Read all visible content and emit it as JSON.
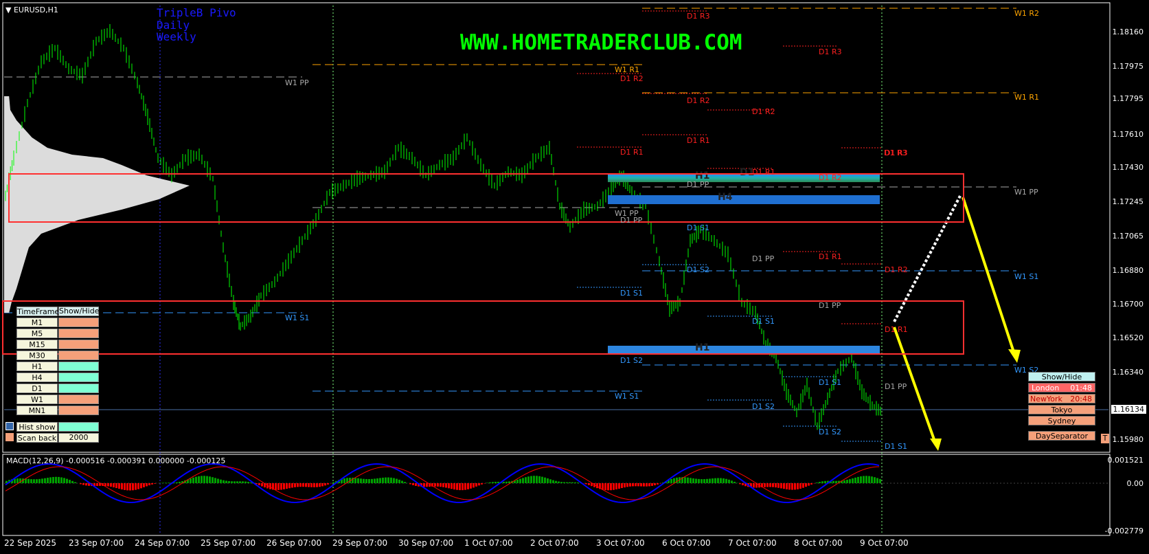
{
  "symbol": "EURUSD,H1",
  "indicator_title": [
    "TripleB Pivo",
    "Daily",
    "Weekly"
  ],
  "watermark": "WWW.HOMETRADERCLUB.COM",
  "macd_label": "MACD(12,26,9) -0.000516 -0.000391 0.000000 -0.000125",
  "price_axis": [
    "1.18160",
    "1.17975",
    "1.17795",
    "1.17610",
    "1.17430",
    "1.17245",
    "1.17065",
    "1.16880",
    "1.16700",
    "1.16520",
    "1.16340",
    "1.16134",
    "1.15980"
  ],
  "current_price": "1.16134",
  "macd_axis": [
    "0.001521",
    "0.00",
    "-0.002779"
  ],
  "time_axis": [
    "22 Sep 2025",
    "23 Sep 07:00",
    "24 Sep 07:00",
    "25 Sep 07:00",
    "26 Sep 07:00",
    "29 Sep 07:00",
    "30 Sep 07:00",
    "1 Oct 07:00",
    "2 Oct 07:00",
    "3 Oct 07:00",
    "6 Oct 07:00",
    "7 Oct 07:00",
    "8 Oct 07:00",
    "9 Oct 07:00"
  ],
  "pivot_labels": {
    "w1_pp_a": "W1 PP",
    "w1_r1_a": "W1 R1",
    "d1_r2_a": "D1 R2",
    "d1_r1_a": "D1 R1",
    "w1_pp_b": "W1 PP",
    "d1_s1_a": "D1 S1",
    "w1_s1_a": "W1 S1",
    "d1_s2_a": "D1 S2",
    "w1_s1_b": "W1 S1",
    "d1_r3_a": "D1 R3",
    "d1_r2_b": "D1 R2",
    "d1_r1_b": "D1 R1",
    "d1_pp_a": "D1 PP",
    "d1_s2_b": "D1 S2",
    "d1_r3_b": "D1 R3",
    "d1_r2_c": "D1 R2",
    "d1_r1_c": "D1 R1",
    "d1_pp_b": "D1 PP",
    "d1_s1_b": "D1 S1",
    "d1_s2_c": "D1 S2",
    "d1_r3_c": "D1 R3",
    "d1_r2_d": "D1 R2",
    "d1_r1_d": "D1 R1",
    "d1_pp_c": "D1 PP",
    "d1_s1_c": "D1 S1",
    "d1_s2_d": "D1 S2",
    "w1_r2": "W1 R2",
    "w1_r1_b": "W1 R1",
    "w1_pp_c": "W1 PP",
    "w1_s1_c": "W1 S1",
    "w1_s2": "W1 S2",
    "d1_r3_d": "D1 R3",
    "d1_r2_e": "D1 R2",
    "d1_r1_e": "D1 R1",
    "d1_pp_d": "D1 PP",
    "d1_s1_d": "D1 S1",
    "d1_pp_e": "D1 PP",
    "d1_s1_e": "D1 S1"
  },
  "zone_labels": {
    "h1_top": "H1",
    "d1_top": "D1",
    "h4": "H4",
    "h1_bottom": "H1"
  },
  "timeframe_panel": {
    "header": "TimeFrame",
    "header_toggle": "Show/Hide",
    "rows": [
      {
        "name": "M1",
        "color": "#f5a07a"
      },
      {
        "name": "M5",
        "color": "#f5a07a"
      },
      {
        "name": "M15",
        "color": "#f5a07a"
      },
      {
        "name": "M30",
        "color": "#f5a07a"
      },
      {
        "name": "H1",
        "color": "#7fffd4"
      },
      {
        "name": "H4",
        "color": "#7fffd4"
      },
      {
        "name": "D1",
        "color": "#7fffd4"
      },
      {
        "name": "W1",
        "color": "#f5a07a"
      },
      {
        "name": "MN1",
        "color": "#f5a07a"
      }
    ],
    "hist_show": "Hist show",
    "scan_back": "Scan back",
    "scan_back_value": "2000"
  },
  "sessions": {
    "toggle": "Show/Hide",
    "london": "London",
    "london_time": "01:48",
    "newyork": "NewYork",
    "newyork_time": "20:48",
    "tokyo": "Tokyo",
    "sydney": "Sydney",
    "day_separator": "DaySeparator",
    "t_button": "T"
  },
  "colors": {
    "bull": "#00ff00",
    "macd_hist_pos": "#00a000",
    "macd_hist_neg": "#ff0000",
    "macd_main": "#0000ff",
    "macd_signal": "#ff0000",
    "zone_outline": "#ff3030",
    "arrow": "#ffff00"
  }
}
